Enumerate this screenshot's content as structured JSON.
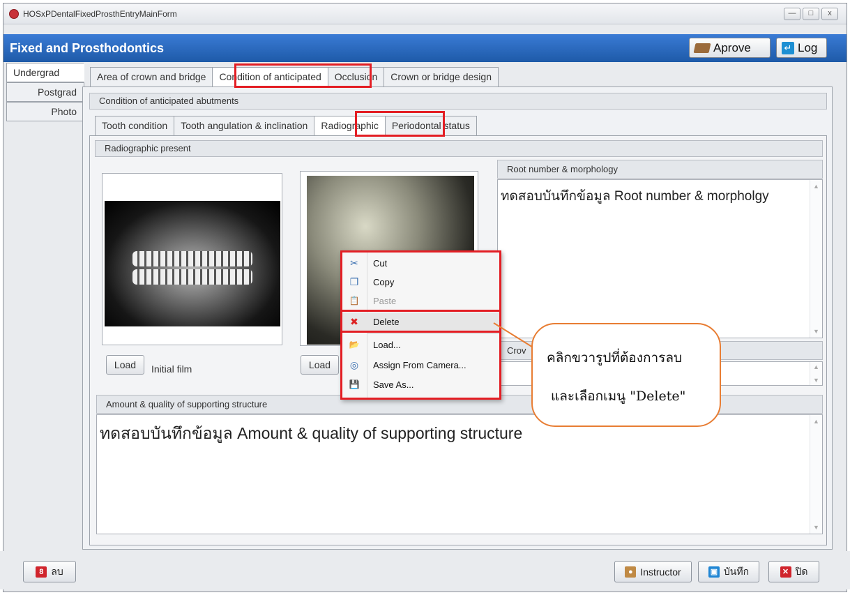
{
  "window": {
    "title": "HOSxPDentalFixedProsthEntryMainForm",
    "min_label": "—",
    "max_label": "□",
    "close_label": "x"
  },
  "header": {
    "title": "Fixed and Prosthodontics",
    "approve_label": "Aprove",
    "log_label": "Log"
  },
  "left_tabs": [
    "Undergrad",
    "Postgrad",
    "Photo"
  ],
  "top_tabs": [
    "Area of crown and bridge",
    "Condition of anticipated",
    "Occlusion",
    "Crown or bridge design"
  ],
  "section_title": "Condition of anticipated abutments",
  "sub_tabs": [
    "Tooth condition",
    "Tooth angulation & inclination",
    "Radiographic",
    "Periodontal status"
  ],
  "radiographic": {
    "group_title": "Radiographic present",
    "load_label": "Load",
    "load2_label": "Load",
    "initial_film_label": "Initial film"
  },
  "root": {
    "title": "Root number & morphology",
    "value": "ทดสอบบันทึกข้อมูล Root number & morpholgy"
  },
  "crown_label_partial": "Crov",
  "amount": {
    "title": "Amount & quality of supporting structure",
    "value": "ทดสอบบันทึกข้อมูล Amount & quality of supporting structure"
  },
  "context_menu": [
    {
      "label": "Cut",
      "icon": "scissors-icon",
      "glyph": "✂",
      "disabled": false
    },
    {
      "label": "Copy",
      "icon": "copy-icon",
      "glyph": "❐",
      "disabled": false
    },
    {
      "label": "Paste",
      "icon": "paste-icon",
      "glyph": "📋",
      "disabled": true
    },
    {
      "label": "Delete",
      "icon": "delete-x-icon",
      "glyph": "✖",
      "disabled": false
    },
    {
      "label": "Load...",
      "icon": "folder-icon",
      "glyph": "📂",
      "disabled": false
    },
    {
      "label": "Assign From Camera...",
      "icon": "camera-icon",
      "glyph": "◎",
      "disabled": false
    },
    {
      "label": "Save As...",
      "icon": "floppy-icon",
      "glyph": "💾",
      "disabled": false
    }
  ],
  "callout": {
    "line1": "คลิกขวารูปที่ต้องการลบ",
    "line2": "และเลือกเมนู \"Delete\""
  },
  "footer": {
    "delete_label": "ลบ",
    "instructor_label": "Instructor",
    "save_label": "บันทึก",
    "close_label": "ปิด"
  },
  "colors": {
    "header_blue": "#1e5aa8",
    "highlight_red": "#e31e24",
    "callout_orange": "#e87d33"
  }
}
